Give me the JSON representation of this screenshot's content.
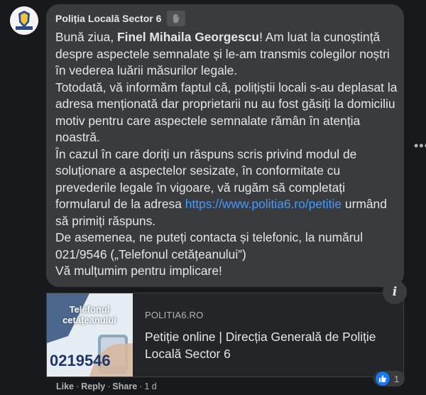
{
  "comment": {
    "author": "Poliția Locală Sector 6",
    "avatar_text": "POLIȚIA LOCALĂ",
    "greeting": "Bună ziua, ",
    "recipient": "Finel Mihaila Georgescu",
    "line1_rest": "! Am luat la cunoștință despre aspectele semnalate și le-am transmis colegilor noștri în vederea luării măsurilor legale.",
    "paragraph2": "Totodată, vă informăm faptul că, polițiștii locali s-au deplasat la adresa menționată dar proprietarii nu au fost găsiți la domiciliu motiv pentru care aspectele semnalate rămân în atenția noastră.",
    "paragraph3_start": "În cazul în care doriți un răspuns scris privind modul de soluționare a aspectelor sesizate, în conformitate cu prevederile legale în vigoare, vă rugăm să completați formularul de la adresa ",
    "link": "https://www.politia6.ro/petitie",
    "paragraph3_end": " urmând să primiți răspuns.",
    "paragraph4": "De asemenea, ne puteți contacta și telefonic, la numărul 021/9546 („Telefonul cetățeanului”)",
    "paragraph5": "Vă mulțumim pentru implicare!"
  },
  "preview": {
    "thumb_title": "Telefonul cetățeanului",
    "thumb_number": "0219546",
    "domain": "POLITIA6.RO",
    "title": "Petiție online | Direcția Generală de Poliție Locală Sector 6"
  },
  "reaction": {
    "count": "1"
  },
  "actions": {
    "like": "Like",
    "reply": "Reply",
    "share": "Share",
    "separator": "·",
    "time": "1 d"
  },
  "colors": {
    "background": "#18191a",
    "bubble": "#3a3b3c",
    "link": "#4599ff",
    "like_blue": "#1877f2"
  }
}
